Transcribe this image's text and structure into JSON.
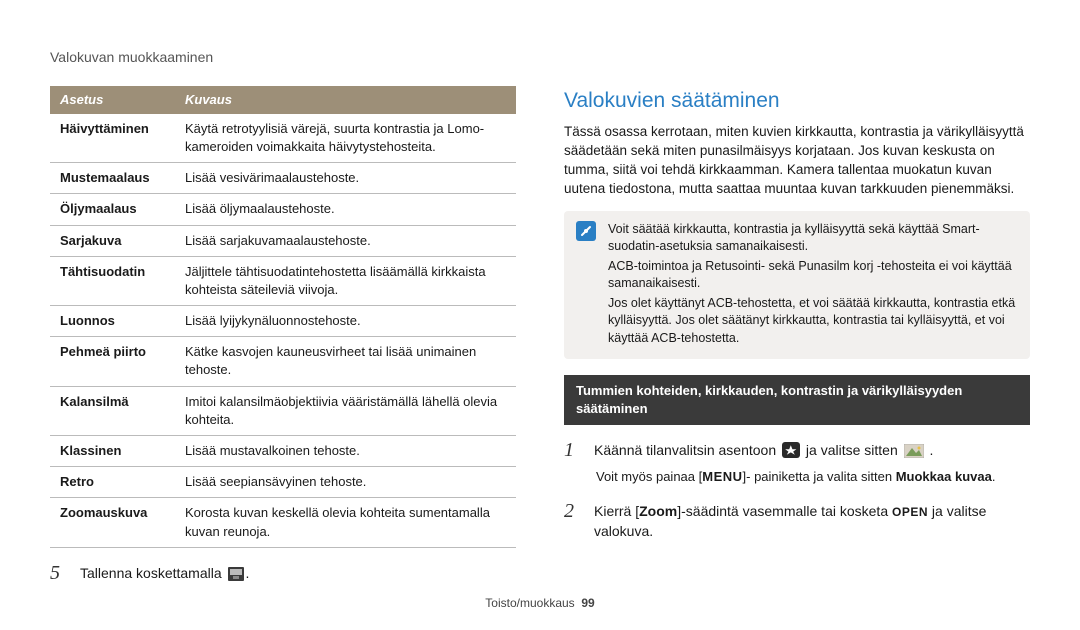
{
  "page_header": "Valokuvan muokkaaminen",
  "table": {
    "head_setting": "Asetus",
    "head_desc": "Kuvaus",
    "rows": [
      {
        "s": "Häivyttäminen",
        "d": "Käytä retrotyylisiä värejä, suurta kontrastia ja Lomo-kameroiden voimakkaita häivytystehosteita."
      },
      {
        "s": "Mustemaalaus",
        "d": "Lisää vesivärimaalaustehoste."
      },
      {
        "s": "Öljymaalaus",
        "d": "Lisää öljymaalaustehoste."
      },
      {
        "s": "Sarjakuva",
        "d": "Lisää sarjakuvamaalaustehoste."
      },
      {
        "s": "Tähtisuodatin",
        "d": "Jäljittele tähtisuodatintehostetta lisäämällä kirkkaista kohteista säteileviä viivoja."
      },
      {
        "s": "Luonnos",
        "d": "Lisää lyijykynäluonnostehoste."
      },
      {
        "s": "Pehmeä piirto",
        "d": "Kätke kasvojen kauneusvirheet tai lisää unimainen tehoste."
      },
      {
        "s": "Kalansilmä",
        "d": "Imitoi kalansilmäobjektiivia vääristämällä lähellä olevia kohteita."
      },
      {
        "s": "Klassinen",
        "d": "Lisää mustavalkoinen tehoste."
      },
      {
        "s": "Retro",
        "d": "Lisää seepiansävyinen tehoste."
      },
      {
        "s": "Zoomauskuva",
        "d": "Korosta kuvan keskellä olevia kohteita sumentamalla kuvan reunoja."
      }
    ]
  },
  "left_step5": "Tallenna koskettamalla ",
  "right": {
    "heading": "Valokuvien säätäminen",
    "intro": "Tässä osassa kerrotaan, miten kuvien kirkkautta, kontrastia ja värikylläisyyttä säädetään sekä miten punasilmäisyys korjataan. Jos kuvan keskusta on tumma, siitä voi tehdä kirkkaamman. Kamera tallentaa muokatun kuvan uutena tiedostona, mutta saattaa muuntaa kuvan tarkkuuden pienemmäksi.",
    "note": [
      "Voit säätää kirkkautta, kontrastia ja kylläisyyttä sekä käyttää Smart-suodatin-asetuksia samanaikaisesti.",
      "ACB-toimintoa ja Retusointi- sekä Punasilm korj -tehosteita ei voi käyttää samanaikaisesti.",
      "Jos olet käyttänyt ACB-tehostetta, et voi säätää kirkkautta, kontrastia etkä kylläisyyttä. Jos olet säätänyt kirkkautta, kontrastia tai kylläisyyttä, et voi käyttää ACB-tehostetta."
    ],
    "darkbar": "Tummien kohteiden, kirkkauden, kontrastin ja värikylläisyyden säätäminen",
    "step1_a": "Käännä tilanvalitsin asentoon ",
    "step1_b": " ja valitse sitten ",
    "step1_c": ".",
    "step1_sub_a": "Voit myös painaa [",
    "step1_sub_menu": "MENU",
    "step1_sub_b": "]- painiketta ja valita sitten ",
    "step1_sub_bold": "Muokkaa kuvaa",
    "step1_sub_c": ".",
    "step2_a": "Kierrä [",
    "step2_zoom": "Zoom",
    "step2_b": "]-säädintä vasemmalle tai kosketa ",
    "step2_open": "OPEN",
    "step2_c": " ja valitse valokuva."
  },
  "footer": {
    "section": "Toisto/muokkaus",
    "page": "99"
  }
}
